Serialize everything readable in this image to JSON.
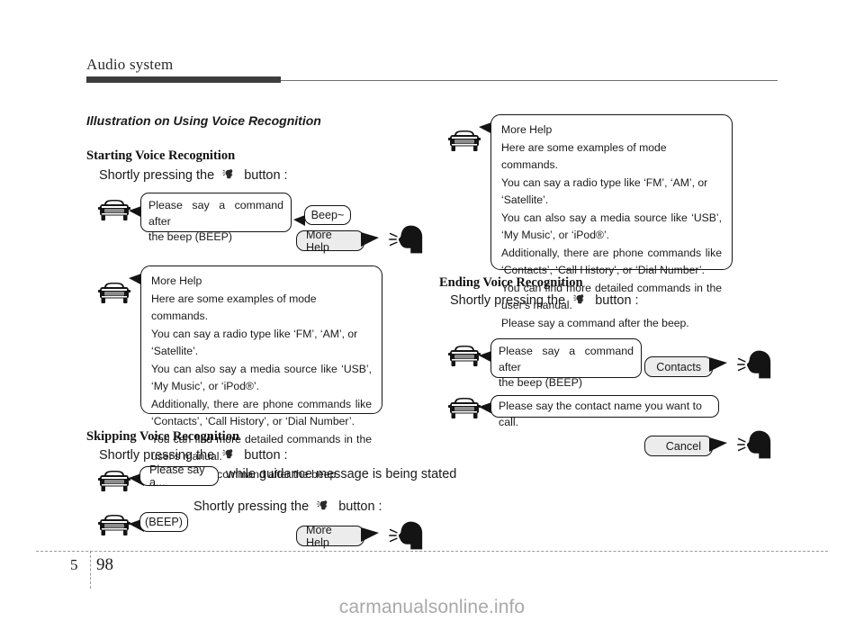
{
  "header": {
    "title": "Audio system"
  },
  "footer": {
    "chapter": "5",
    "page": "98",
    "watermark": "carmanualsonline.info"
  },
  "section": {
    "title": "Illustration on Using Voice Recognition"
  },
  "icons": {
    "car": "car-front-icon",
    "head": "talking-head-icon",
    "vr_button": "voice-recognition-button-icon"
  },
  "starting": {
    "heading": "Starting Voice Recognition",
    "press_prefix": "Shortly pressing the",
    "press_suffix": "button :",
    "car_bubble": {
      "line1": "Please say a command after",
      "line2": "the beep (BEEP)"
    },
    "beep_pill": "Beep~",
    "more_help_pill": "More Help",
    "help_bubble": {
      "title": "More Help",
      "lines": [
        "Here are some examples of mode commands.",
        "You can say a radio type like ‘FM’, ‘AM’, or ‘Satellite’.",
        "You can also say a media source like ‘USB’, ‘My Music’, or ‘iPod®’.",
        "Additionally, there are phone commands like ‘Contacts’, ‘Call History’, or ‘Dial Number’.",
        "You can find more detailed commands in the user's manual.",
        "Please say a command after the beep."
      ]
    }
  },
  "skipping": {
    "heading": "Skipping Voice Recognition",
    "press_prefix": "Shortly pressing the",
    "press_suffix": "button :",
    "partial_pill": "Please say a...",
    "note": "while guidance message is being stated",
    "press2_prefix": "Shortly pressing the",
    "press2_suffix": "button :",
    "beep_pill": "(BEEP)",
    "more_help_pill": "More Help"
  },
  "ending": {
    "help_bubble": {
      "title": "More Help",
      "lines": [
        "Here are some examples of mode commands.",
        "You can say a radio type like ‘FM’, ‘AM’, or ‘Satellite’.",
        "You can also say a media source like ‘USB’, ‘My Music’, or ‘iPod®’.",
        "Additionally, there are phone commands like ‘Contacts’, ‘Call History’, or ‘Dial Number’.",
        "You can find more detailed commands in the user's manual.",
        "Please say a command after the beep."
      ]
    },
    "heading": "Ending Voice Recognition",
    "press_prefix": "Shortly pressing the",
    "press_suffix": "button :",
    "car_bubble": {
      "line1": "Please say a command after",
      "line2": "the beep (BEEP)"
    },
    "contacts_pill": "Contacts",
    "contact_name_bubble": "Please say the contact name you want to call.",
    "cancel_pill": "Cancel"
  }
}
